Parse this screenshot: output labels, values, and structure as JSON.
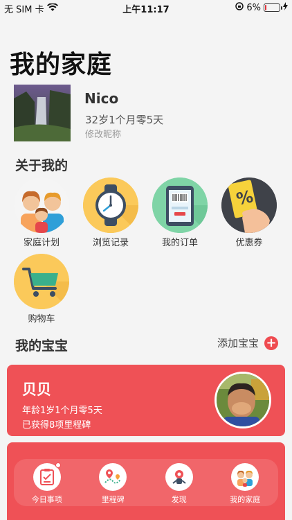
{
  "status_bar": {
    "carrier": "无 SIM 卡",
    "time": "上午11:17",
    "battery_percent": "6%",
    "battery_level": 0.06
  },
  "page": {
    "title": "我的家庭"
  },
  "profile": {
    "name": "Nico",
    "age": "32岁1个月零5天",
    "edit_label": "修改昵称"
  },
  "about": {
    "title": "关于我的",
    "items": [
      {
        "label": "家庭计划",
        "icon": "family-icon"
      },
      {
        "label": "浏览记录",
        "icon": "clock-icon"
      },
      {
        "label": "我的订单",
        "icon": "order-icon"
      },
      {
        "label": "优惠券",
        "icon": "coupon-icon"
      },
      {
        "label": "购物车",
        "icon": "cart-icon"
      }
    ]
  },
  "babies": {
    "title": "我的宝宝",
    "add_label": "添加宝宝",
    "cards": [
      {
        "name": "贝贝",
        "age": "年龄1岁1个月零5天",
        "milestones": "已获得8项里程碑"
      }
    ]
  },
  "tab_bar": {
    "tabs": [
      {
        "label": "今日事项",
        "icon": "checklist-icon"
      },
      {
        "label": "里程碑",
        "icon": "map-pin-icon"
      },
      {
        "label": "发现",
        "icon": "robot-icon"
      },
      {
        "label": "我的家庭",
        "icon": "family-icon"
      }
    ]
  },
  "colors": {
    "accent": "#ef5156",
    "background": "#f4f4f4"
  }
}
